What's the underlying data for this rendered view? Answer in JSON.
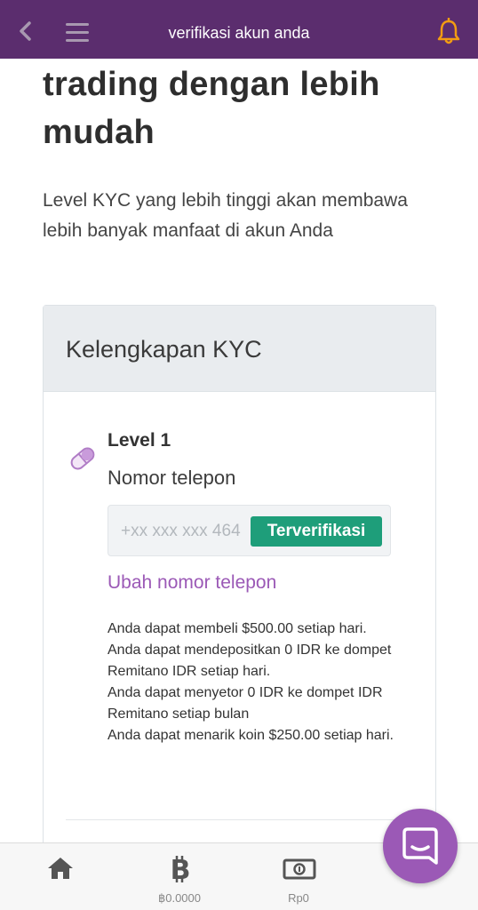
{
  "header": {
    "title": "verifikasi akun anda",
    "back_icon": "chevron-left-icon",
    "menu_icon": "hamburger-icon",
    "notification_icon": "bell-icon"
  },
  "main": {
    "heading": "trading dengan lebih mudah",
    "intro": "Level KYC yang lebih tinggi akan membawa lebih banyak manfaat di akun Anda"
  },
  "kyc_card": {
    "title": "Kelengkapan KYC",
    "level": {
      "icon": "pill-icon",
      "title": "Level 1",
      "phone_label": "Nomor telepon",
      "phone_value": "+xx xxx xxx 464",
      "status_badge": "Terverifikasi",
      "change_link": "Ubah nomor telepon",
      "benefits": [
        "Anda dapat membeli $500.00 setiap hari.",
        "Anda dapat mendepositkan 0 IDR ke dompet Remitano IDR setiap hari.",
        "Anda dapat menyetor 0 IDR ke dompet IDR Remitano setiap bulan",
        "Anda dapat menarik koin $250.00 setiap hari."
      ]
    }
  },
  "bottom_nav": {
    "items": [
      {
        "icon": "home-icon",
        "label": ""
      },
      {
        "icon": "bitcoin-icon",
        "label": "฿0.0000"
      },
      {
        "icon": "banknote-icon",
        "label": "Rp0"
      }
    ]
  },
  "chat": {
    "icon": "chat-icon"
  },
  "colors": {
    "header_bg": "#5b2d6e",
    "accent": "#9b59b6",
    "verified": "#1e9e7a",
    "bell": "#f39c12"
  }
}
